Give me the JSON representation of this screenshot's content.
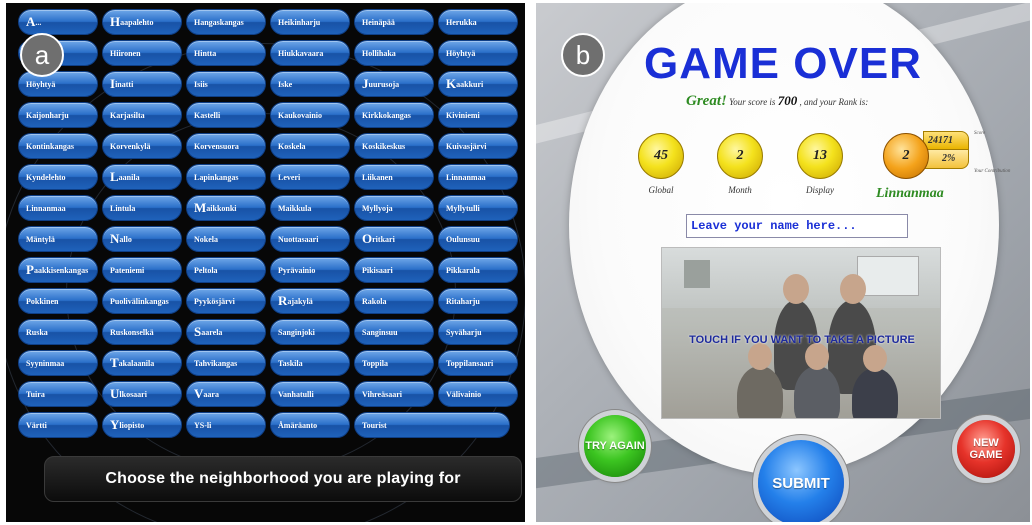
{
  "panel_a": {
    "badge": "a",
    "neighborhoods": [
      {
        "cap": "A",
        "rest": "..."
      },
      {
        "cap": "H",
        "rest": "aapalehto"
      },
      {
        "cap": "",
        "rest": "Hangaskangas"
      },
      {
        "cap": "",
        "rest": "Heikinharju"
      },
      {
        "cap": "",
        "rest": "Heinäpää"
      },
      {
        "cap": "",
        "rest": "Herukka"
      },
      {
        "cap": "",
        "rest": "Hietasaari"
      },
      {
        "cap": "",
        "rest": "Hiironen"
      },
      {
        "cap": "",
        "rest": "Hintta"
      },
      {
        "cap": "",
        "rest": "Hiukkavaara"
      },
      {
        "cap": "",
        "rest": "Hollihaka"
      },
      {
        "cap": "",
        "rest": "Höyhtyä"
      },
      {
        "cap": "",
        "rest": "Höyhtyä"
      },
      {
        "cap": "I",
        "rest": "inatti"
      },
      {
        "cap": "",
        "rest": "Isiis"
      },
      {
        "cap": "",
        "rest": "Iske"
      },
      {
        "cap": "J",
        "rest": "uurusoja"
      },
      {
        "cap": "K",
        "rest": "aakkuri"
      },
      {
        "cap": "",
        "rest": "Kaijonharju"
      },
      {
        "cap": "",
        "rest": "Karjasilta"
      },
      {
        "cap": "",
        "rest": "Kastelli"
      },
      {
        "cap": "",
        "rest": "Kaukovainio"
      },
      {
        "cap": "",
        "rest": "Kirkkokangas"
      },
      {
        "cap": "",
        "rest": "Kiviniemi"
      },
      {
        "cap": "",
        "rest": "Kontinkangas"
      },
      {
        "cap": "",
        "rest": "Korvenkylä"
      },
      {
        "cap": "",
        "rest": "Korvensuora"
      },
      {
        "cap": "",
        "rest": "Koskela"
      },
      {
        "cap": "",
        "rest": "Koskikeskus"
      },
      {
        "cap": "",
        "rest": "Kuivasjärvi"
      },
      {
        "cap": "",
        "rest": "Kyndelehto"
      },
      {
        "cap": "L",
        "rest": "aanila"
      },
      {
        "cap": "",
        "rest": "Lapinkangas"
      },
      {
        "cap": "",
        "rest": "Leveri"
      },
      {
        "cap": "",
        "rest": "Liikanen"
      },
      {
        "cap": "",
        "rest": "Linnanmaa"
      },
      {
        "cap": "",
        "rest": "Linnanmaa"
      },
      {
        "cap": "",
        "rest": "Lintula"
      },
      {
        "cap": "M",
        "rest": "aikkonki"
      },
      {
        "cap": "",
        "rest": "Maikkula"
      },
      {
        "cap": "",
        "rest": "Myllyoja"
      },
      {
        "cap": "",
        "rest": "Myllytulli"
      },
      {
        "cap": "",
        "rest": "Mäntylä"
      },
      {
        "cap": "N",
        "rest": "allo"
      },
      {
        "cap": "",
        "rest": "Nokela"
      },
      {
        "cap": "",
        "rest": "Nuottasaari"
      },
      {
        "cap": "O",
        "rest": "ritkari"
      },
      {
        "cap": "",
        "rest": "Oulunsuu"
      },
      {
        "cap": "P",
        "rest": "aakkisenkangas"
      },
      {
        "cap": "",
        "rest": "Pateniemi"
      },
      {
        "cap": "",
        "rest": "Peltola"
      },
      {
        "cap": "",
        "rest": "Pyrävainio"
      },
      {
        "cap": "",
        "rest": "Pikisaari"
      },
      {
        "cap": "",
        "rest": "Pikkarala"
      },
      {
        "cap": "",
        "rest": "Pokkinen"
      },
      {
        "cap": "",
        "rest": "Puolivälinkangas"
      },
      {
        "cap": "",
        "rest": "Pyykösjärvi"
      },
      {
        "cap": "R",
        "rest": "ajakylä"
      },
      {
        "cap": "",
        "rest": "Rakola"
      },
      {
        "cap": "",
        "rest": "Ritaharju"
      },
      {
        "cap": "",
        "rest": "Ruska"
      },
      {
        "cap": "",
        "rest": "Ruskonselkä"
      },
      {
        "cap": "S",
        "rest": "aarela"
      },
      {
        "cap": "",
        "rest": "Sanginjoki"
      },
      {
        "cap": "",
        "rest": "Sanginsuu"
      },
      {
        "cap": "",
        "rest": "Syväharju"
      },
      {
        "cap": "",
        "rest": "Syyninmaa"
      },
      {
        "cap": "T",
        "rest": "akalaanila"
      },
      {
        "cap": "",
        "rest": "Tahvikangas"
      },
      {
        "cap": "",
        "rest": "Taskila"
      },
      {
        "cap": "",
        "rest": "Toppila"
      },
      {
        "cap": "",
        "rest": "Toppilansaari"
      },
      {
        "cap": "",
        "rest": "Tuira"
      },
      {
        "cap": "U",
        "rest": "lkosaari"
      },
      {
        "cap": "V",
        "rest": "aara"
      },
      {
        "cap": "",
        "rest": "Vanhatulli"
      },
      {
        "cap": "",
        "rest": "Vihreäsaari"
      },
      {
        "cap": "",
        "rest": "Välivainio"
      },
      {
        "cap": "",
        "rest": "Värtti"
      },
      {
        "cap": "Y",
        "rest": "liopisto"
      },
      {
        "cap": "",
        "rest": "YS-li"
      },
      {
        "cap": "",
        "rest": "Åmäräanto"
      },
      {
        "cap": "",
        "rest": "Tourist"
      }
    ],
    "choose_text": "Choose the neighborhood you are playing for"
  },
  "panel_b": {
    "badge": "b",
    "title": "GAME OVER",
    "score_line": {
      "great": "Great!",
      "pre": "Your score is",
      "score": "700",
      "post": ", and your Rank is:"
    },
    "ranks": [
      {
        "value": "45",
        "label": "Global"
      },
      {
        "value": "2",
        "label": "Month"
      },
      {
        "value": "13",
        "label": "Display"
      }
    ],
    "neighborhood_rank": {
      "value": "2",
      "score": "24171",
      "percent": "2%",
      "small_top": "Score",
      "small_bottom": "Your Contribution"
    },
    "neighborhood_name": "Linnanmaa",
    "name_placeholder": "Leave your name here...",
    "photo_prompt": "TOUCH IF YOU WANT TO TAKE A PICTURE",
    "buttons": {
      "try_again": "TRY AGAIN",
      "submit": "SUBMIT",
      "new_game": "NEW GAME"
    },
    "colors": {
      "title": "#1a2fd6",
      "great": "#2e8b22",
      "orb": "#f4e21d"
    }
  }
}
